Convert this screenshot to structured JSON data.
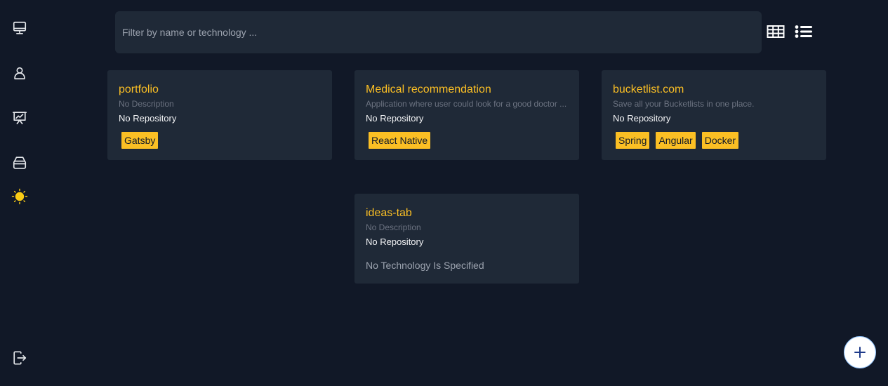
{
  "sidebar": {
    "items": [
      {
        "icon": "monitor-icon"
      },
      {
        "icon": "user-icon"
      },
      {
        "icon": "presentation-chart-icon"
      },
      {
        "icon": "inbox-stack-icon"
      },
      {
        "icon": "sun-icon"
      },
      {
        "icon": "logout-icon"
      }
    ]
  },
  "search": {
    "placeholder": "Filter by name or technology ...",
    "value": ""
  },
  "view_toggle": {
    "grid_icon": "table-grid-icon",
    "list_icon": "list-icon"
  },
  "projects": [
    {
      "title": "portfolio",
      "description": "No Description",
      "repository": "No Repository",
      "tags": [
        "Gatsby"
      ]
    },
    {
      "title": "Medical recommendation",
      "description": "Application where user could look for a good doctor ...",
      "repository": "No Repository",
      "tags": [
        "React Native"
      ]
    },
    {
      "title": "bucketlist.com",
      "description": "Save all your Bucketlists in one place.",
      "repository": "No Repository",
      "tags": [
        "Spring",
        "Angular",
        "Docker"
      ]
    },
    {
      "title": "ideas-tab",
      "description": "No Description",
      "repository": "No Repository",
      "tags": [],
      "no_tech_text": "No Technology Is Specified"
    }
  ],
  "fab": {
    "icon": "plus-icon"
  },
  "colors": {
    "background": "#111827",
    "card": "#1f2937",
    "accent": "#fbbf24",
    "fab_icon": "#1e3a8a"
  }
}
